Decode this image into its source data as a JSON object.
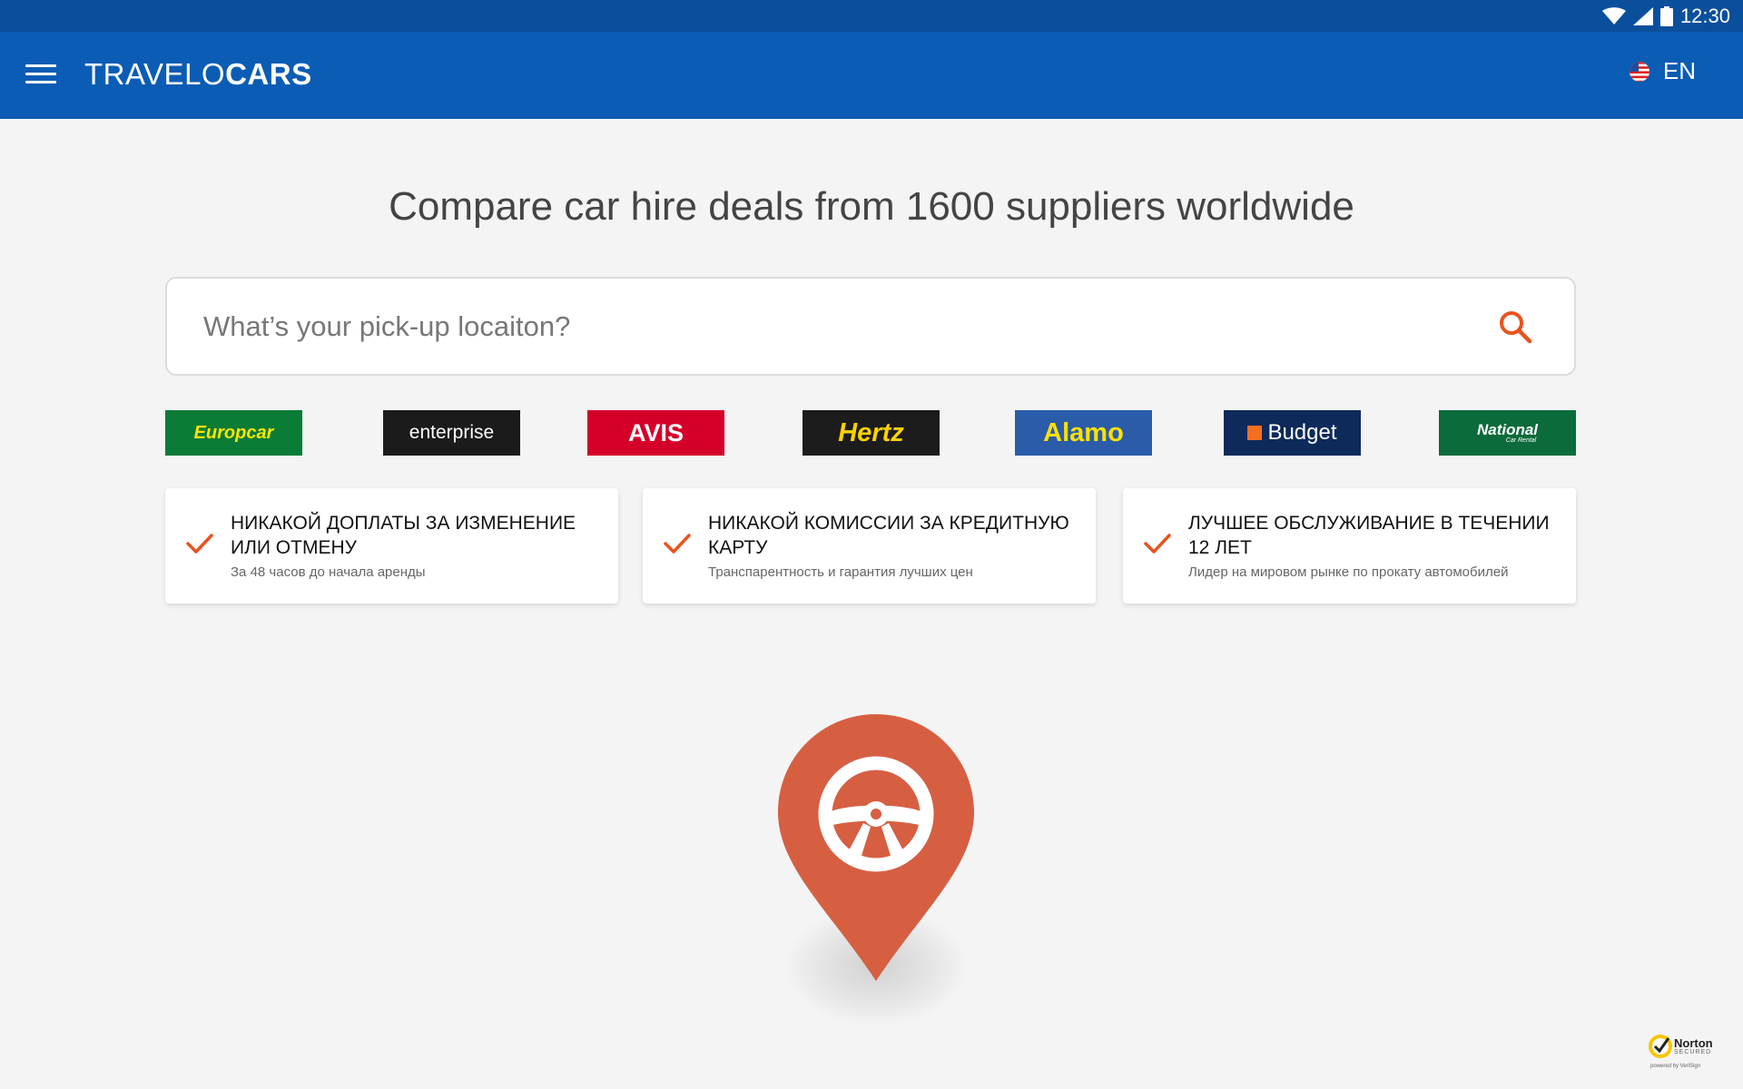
{
  "status_bar": {
    "time": "12:30",
    "icons": [
      "wifi-icon",
      "signal-icon",
      "battery-icon"
    ]
  },
  "app_bar": {
    "brand_light": "TRAVELO",
    "brand_bold": "CARS",
    "language_code": "EN",
    "language_flag": "us-flag-icon",
    "color": "#0b5cb4"
  },
  "headline": "Compare car hire deals from 1600 suppliers worldwide",
  "search": {
    "placeholder": "What’s your pick-up locaiton?",
    "value": ""
  },
  "suppliers": [
    {
      "name": "Europcar",
      "bg": "#0a7c36",
      "fg": "#ffe400"
    },
    {
      "name": "enterprise",
      "bg": "#1b1b1b",
      "fg": "#ffffff"
    },
    {
      "name": "AVIS",
      "bg": "#d4002a",
      "fg": "#ffffff"
    },
    {
      "name": "Hertz",
      "bg": "#1c1c1c",
      "fg": "#ffd200"
    },
    {
      "name": "Alamo",
      "bg": "#2a5caa",
      "fg": "#ffe100"
    },
    {
      "name": "Budget",
      "bg": "#0d2a5a",
      "fg": "#ffffff"
    },
    {
      "name": "National",
      "bg": "#0b6b3a",
      "fg": "#ffffff",
      "tagline": "Car Rental"
    }
  ],
  "features": [
    {
      "title": "НИКАКОЙ ДОПЛАТЫ ЗА ИЗМЕНЕНИЕ ИЛИ ОТМЕНУ",
      "subtitle": "За 48 часов до начала аренды"
    },
    {
      "title": "НИКАКОЙ КОМИССИИ ЗА КРЕДИТНУЮ КАРТУ",
      "subtitle": "Транспарентность и гарантия лучших цен"
    },
    {
      "title": "ЛУЧШЕЕ ОБСЛУЖИВАНИЕ В ТЕЧЕНИИ 12 ЛЕТ",
      "subtitle": "Лидер на мировом рынке по прокату автомобилей"
    }
  ],
  "accent_color": "#e8531f",
  "pin_color": "#d65f42",
  "illustration": "steering-wheel-pin-icon",
  "norton": {
    "brand": "Norton",
    "label": "SECURED",
    "powered": "powered by VeriSign"
  }
}
